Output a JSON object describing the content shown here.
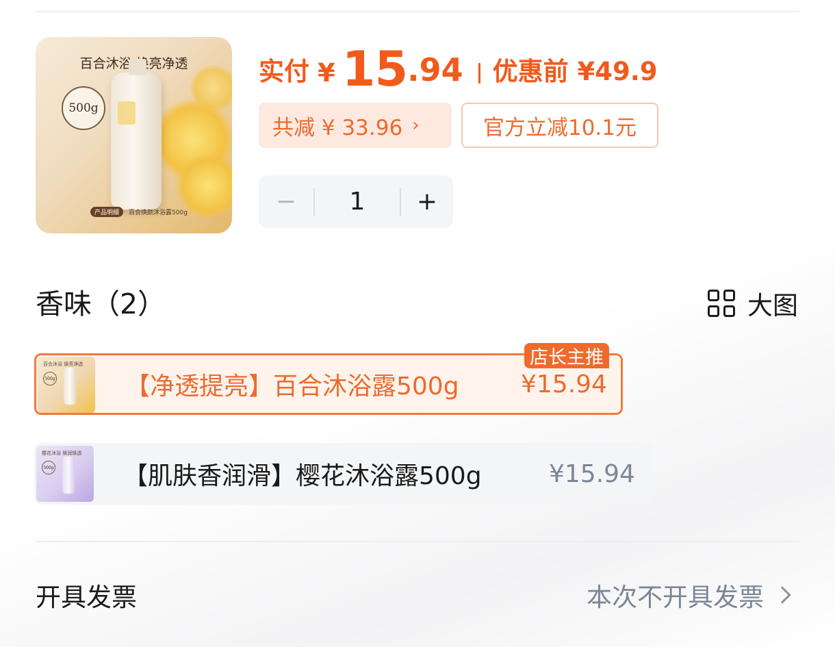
{
  "product": {
    "image_title": "百合沐浴 焕亮净透",
    "image_badge": "500g",
    "image_tag": "产品明细",
    "image_caption": "百合焕颜沐浴露500g"
  },
  "price": {
    "pay_label": "实付",
    "currency": "¥",
    "price_int": "15",
    "price_dec": ".94",
    "before_label": "优惠前 ¥49.9"
  },
  "discount": {
    "total_label": "共减 ¥ 33.96",
    "official_label": "官方立减10.1元"
  },
  "stepper": {
    "minus": "−",
    "quantity": "1",
    "plus": "+"
  },
  "scent_section": {
    "title": "香味（2）",
    "big_view_label": "大图",
    "options": [
      {
        "name": "【净透提亮】百合沐浴露500g",
        "price": "¥15.94",
        "badge": "店长主推",
        "selected": true,
        "thumb_title": "百合沐浴 焕亮净透",
        "thumb_badge": "500g"
      },
      {
        "name": "【肌肤香润滑】樱花沐浴露500g",
        "price": "¥15.94",
        "selected": false,
        "thumb_title": "樱花沐浴 焕润焕透",
        "thumb_badge": "500g"
      }
    ]
  },
  "invoice": {
    "label": "开具发票",
    "value": "本次不开具发票"
  },
  "colors": {
    "accent": "#f25a1c",
    "accent_soft": "#fde9df",
    "muted_text": "#7c8696"
  }
}
